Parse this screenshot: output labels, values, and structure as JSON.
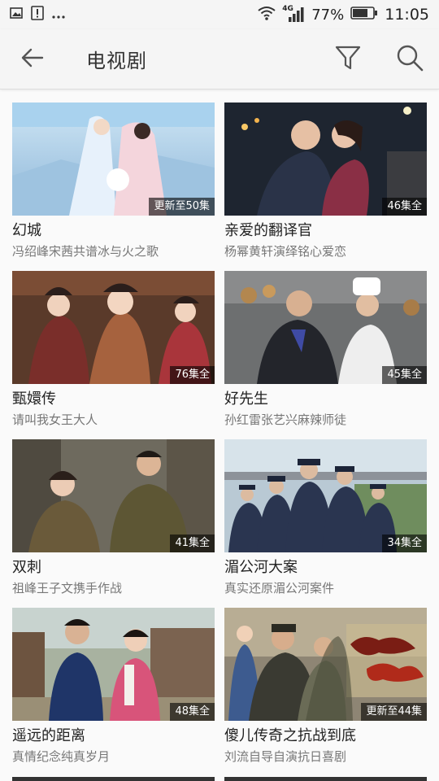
{
  "status_bar": {
    "signal_text": "4G",
    "battery_percent": "77%",
    "time": "11:05",
    "battery_level": 0.77
  },
  "header": {
    "title": "电视剧",
    "back_icon": "arrow-left-icon",
    "filter_icon": "filter-icon",
    "search_icon": "search-icon"
  },
  "shows": [
    {
      "title": "幻城",
      "subtitle": "冯绍峰宋茜共谱冰与火之歌",
      "badge": "更新至50集"
    },
    {
      "title": "亲爱的翻译官",
      "subtitle": "杨幂黄轩演绎铭心爱恋",
      "badge": "46集全"
    },
    {
      "title": "甄嬛传",
      "subtitle": "请叫我女王大人",
      "badge": "76集全"
    },
    {
      "title": "好先生",
      "subtitle": "孙红雷张艺兴麻辣师徒",
      "badge": "45集全"
    },
    {
      "title": "双刺",
      "subtitle": "祖峰王子文携手作战",
      "badge": "41集全"
    },
    {
      "title": "湄公河大案",
      "subtitle": "真实还原湄公河案件",
      "badge": "34集全"
    },
    {
      "title": "遥远的距离",
      "subtitle": "真情纪念纯真岁月",
      "badge": "48集全"
    },
    {
      "title": "傻儿传奇之抗战到底",
      "subtitle": "刘流自导自演抗日喜剧",
      "badge": "更新至44集"
    }
  ]
}
